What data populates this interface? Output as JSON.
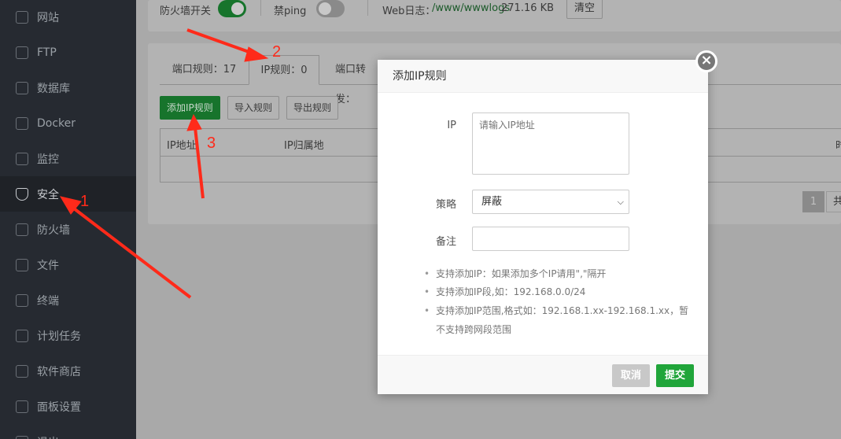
{
  "sidebar": {
    "items": [
      {
        "label": "网站",
        "icon": "globe-icon"
      },
      {
        "label": "FTP",
        "icon": "ftp-icon"
      },
      {
        "label": "数据库",
        "icon": "database-icon"
      },
      {
        "label": "Docker",
        "icon": "docker-icon"
      },
      {
        "label": "监控",
        "icon": "monitor-icon"
      },
      {
        "label": "安全",
        "icon": "shield-check-icon",
        "active": true
      },
      {
        "label": "防火墙",
        "icon": "firewall-icon"
      },
      {
        "label": "文件",
        "icon": "folder-icon"
      },
      {
        "label": "终端",
        "icon": "terminal-icon"
      },
      {
        "label": "计划任务",
        "icon": "calendar-icon"
      },
      {
        "label": "软件商店",
        "icon": "apps-icon"
      },
      {
        "label": "面板设置",
        "icon": "gear-icon"
      },
      {
        "label": "退出",
        "icon": "logout-icon"
      }
    ]
  },
  "topbar": {
    "firewall_label": "防火墙开关",
    "firewall_on": true,
    "ping_label": "禁ping",
    "ping_on": false,
    "weblog_label": "Web日志：",
    "weblog_path": "/www/wwwlogs",
    "weblog_size": "271.16 KB",
    "clear_label": "清空"
  },
  "tabs": [
    {
      "label": "端口规则：17"
    },
    {
      "label": "IP规则：0",
      "active": true
    },
    {
      "label": "端口转发："
    }
  ],
  "toolbar": {
    "add": "添加IP规则",
    "import": "导入规则",
    "export": "导出规则"
  },
  "table": {
    "headers": [
      "IP地址",
      "IP归属地",
      "时"
    ]
  },
  "pagination": {
    "current": "1",
    "total_prefix": "共"
  },
  "modal": {
    "title": "添加IP规则",
    "ip_label": "IP",
    "ip_placeholder": "请输入IP地址",
    "policy_label": "策略",
    "policy_value": "屏蔽",
    "note_label": "备注",
    "note_value": "",
    "tips": [
      "支持添加IP：如果添加多个IP请用\",\"隔开",
      "支持添加IP段,如：192.168.0.0/24",
      "支持添加IP范围,格式如：192.168.1.xx-192.168.1.xx，暂不支持跨网段范围"
    ],
    "cancel": "取消",
    "submit": "提交"
  },
  "annotations": [
    "1",
    "2",
    "3"
  ],
  "colors": {
    "accent": "#20a53a",
    "annotation": "#ff2a1a"
  }
}
